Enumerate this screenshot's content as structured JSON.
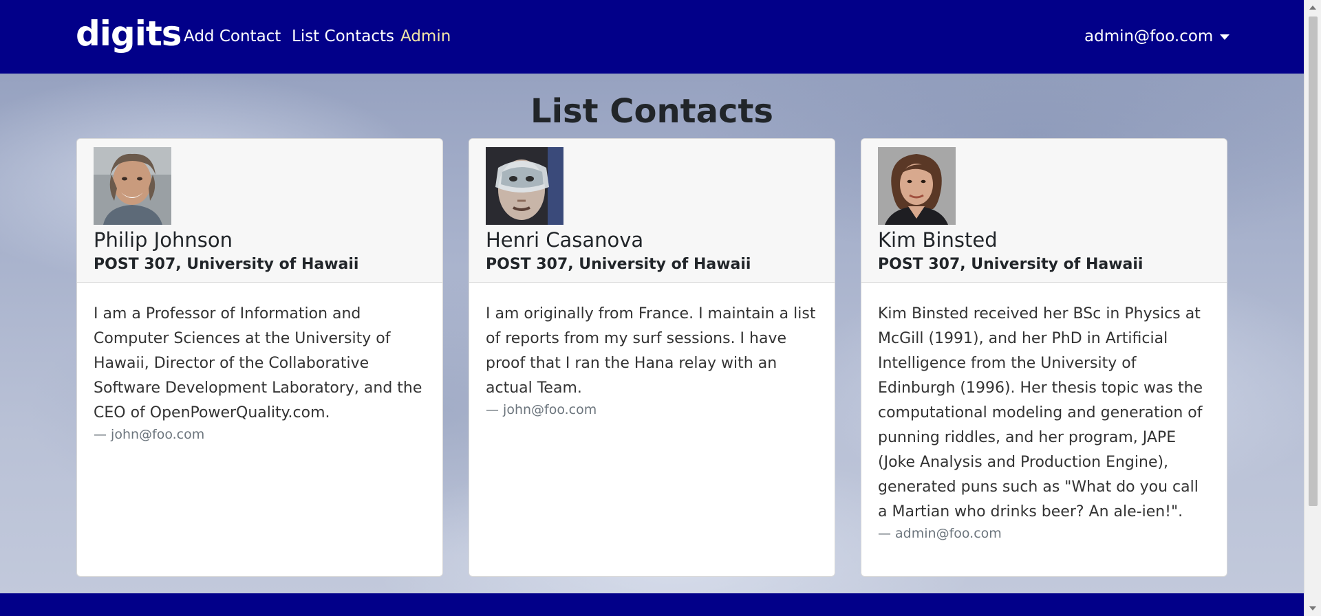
{
  "navbar": {
    "brand": "digits",
    "links": [
      {
        "label": "Add Contact"
      },
      {
        "label": "List Contacts"
      },
      {
        "label": "Admin"
      }
    ],
    "user": "admin@foo.com"
  },
  "page": {
    "title": "List Contacts"
  },
  "contacts": [
    {
      "name": "Philip Johnson",
      "address": "POST 307, University of Hawaii",
      "description": "I am a Professor of Information and Computer Sciences at the University of Hawaii, Director of the Collaborative Software Development Laboratory, and the CEO of OpenPowerQuality.com.",
      "owner": "— john@foo.com"
    },
    {
      "name": "Henri Casanova",
      "address": "POST 307, University of Hawaii",
      "description": "I am originally from France. I maintain a list of reports from my surf sessions. I have proof that I ran the Hana relay with an actual Team.",
      "owner": "— john@foo.com"
    },
    {
      "name": "Kim Binsted",
      "address": "POST 307, University of Hawaii",
      "description": "Kim Binsted received her BSc in Physics at McGill (1991), and her PhD in Artificial Intelligence from the University of Edinburgh (1996). Her thesis topic was the computational modeling and generation of punning riddles, and her program, JAPE (Joke Analysis and Production Engine), generated puns such as \"What do you call a Martian who drinks beer? An ale-ien!\".",
      "owner": "— admin@foo.com"
    }
  ],
  "colors": {
    "navbar": "#020089",
    "active_link": "#f3e6a6"
  }
}
